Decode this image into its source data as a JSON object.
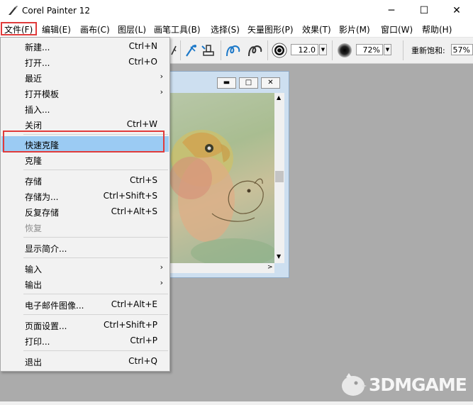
{
  "window": {
    "title": "Corel Painter 12",
    "minimize": "─",
    "maximize": "☐",
    "close": "✕"
  },
  "menubar": [
    {
      "label": "文件(F)"
    },
    {
      "label": "编辑(E)"
    },
    {
      "label": "画布(C)"
    },
    {
      "label": "图层(L)"
    },
    {
      "label": "画笔工具(B)"
    },
    {
      "label": "选择(S)"
    },
    {
      "label": "矢量图形(P)"
    },
    {
      "label": "效果(T)"
    },
    {
      "label": "影片(M)"
    },
    {
      "label": "窗口(W)"
    },
    {
      "label": "帮助(H)"
    }
  ],
  "toolbar": {
    "size_value": "12.0",
    "opacity_value": "72%",
    "resaturation_label": "重新饱和:",
    "resaturation_value": "57%"
  },
  "file_menu": {
    "items": [
      {
        "label": "新建...",
        "shortcut": "Ctrl+N"
      },
      {
        "label": "打开...",
        "shortcut": "Ctrl+O"
      },
      {
        "label": "最近",
        "submenu": true
      },
      {
        "label": "打开模板",
        "submenu": true
      },
      {
        "label": "插入..."
      },
      {
        "label": "关闭",
        "shortcut": "Ctrl+W"
      },
      {
        "label": "快速克隆",
        "highlighted": true
      },
      {
        "label": "克隆"
      },
      {
        "label": "存储",
        "shortcut": "Ctrl+S"
      },
      {
        "label": "存储为...",
        "shortcut": "Ctrl+Shift+S"
      },
      {
        "label": "反复存储",
        "shortcut": "Ctrl+Alt+S"
      },
      {
        "label": "恢复",
        "disabled": true
      },
      {
        "label": "显示简介..."
      },
      {
        "label": "输入",
        "submenu": true
      },
      {
        "label": "输出",
        "submenu": true
      },
      {
        "label": "电子邮件图像...",
        "shortcut": "Ctrl+Alt+E"
      },
      {
        "label": "页面设置...",
        "shortcut": "Ctrl+Shift+P"
      },
      {
        "label": "打印...",
        "shortcut": "Ctrl+P"
      },
      {
        "label": "退出",
        "shortcut": "Ctrl+Q"
      }
    ]
  },
  "watermark": {
    "text": "3DMGAME"
  },
  "colors": {
    "highlight": "#9bcbf3",
    "annotation": "#e03b3b",
    "workspace": "#ababab"
  }
}
